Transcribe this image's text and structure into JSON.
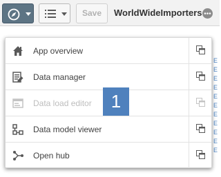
{
  "toolbar": {
    "navigation_icon": "compass-icon",
    "list_icon": "list-icon",
    "save_label": "Save",
    "app_title": "WorldWideImporters",
    "more_icon": "more-options-icon"
  },
  "menu": {
    "items": [
      {
        "label": "App overview",
        "icon": "home-icon",
        "enabled": true
      },
      {
        "label": "Data manager",
        "icon": "data-manager-icon",
        "enabled": true
      },
      {
        "label": "Data load editor",
        "icon": "data-load-editor-icon",
        "enabled": false
      },
      {
        "label": "Data model viewer",
        "icon": "data-model-viewer-icon",
        "enabled": true
      },
      {
        "label": "Open hub",
        "icon": "hub-icon",
        "enabled": true
      }
    ],
    "open_in_new_tab_icon": "open-new-tab-icon"
  },
  "callout": {
    "text": "1",
    "color": "#4f81bd"
  },
  "colors": {
    "nav_button": "#5d7484",
    "text": "#404040",
    "disabled_text": "#bdbdbd"
  }
}
